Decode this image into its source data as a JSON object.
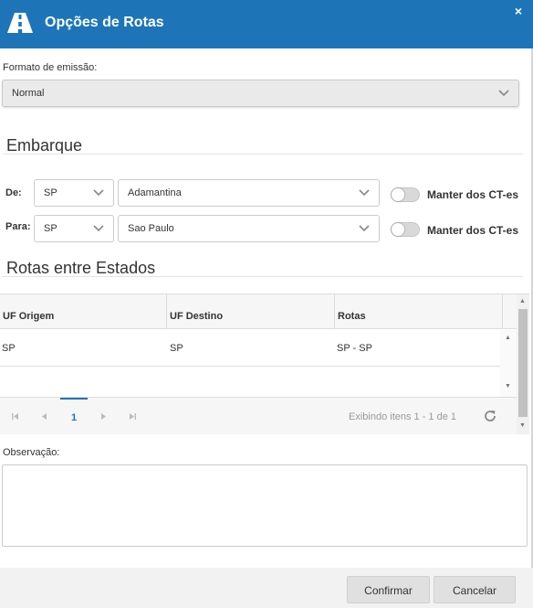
{
  "window": {
    "title": "Opções de Rotas",
    "close_label": "×"
  },
  "formato": {
    "label": "Formato de emissão:",
    "value": "Normal"
  },
  "embarque": {
    "title": "Embarque",
    "de": {
      "label": "De:",
      "uf": "SP",
      "cidade": "Adamantina",
      "toggle_label": "Manter dos CT-es",
      "toggle_on": false
    },
    "para": {
      "label": "Para:",
      "uf": "SP",
      "cidade": "Sao Paulo",
      "toggle_label": "Manter dos CT-es",
      "toggle_on": false
    }
  },
  "rotas": {
    "title": "Rotas entre Estados",
    "columns": [
      "UF Origem",
      "UF Destino",
      "Rotas"
    ],
    "rows": [
      {
        "uf_origem": "SP",
        "uf_destino": "SP",
        "rotas": "SP - SP"
      }
    ],
    "pager": {
      "current_page": "1",
      "info": "Exibindo itens 1 - 1 de 1"
    }
  },
  "observacao": {
    "label": "Observação:",
    "value": ""
  },
  "footer": {
    "confirm_label": "Confirmar",
    "cancel_label": "Cancelar"
  },
  "colors": {
    "accent": "#1d75b8"
  }
}
